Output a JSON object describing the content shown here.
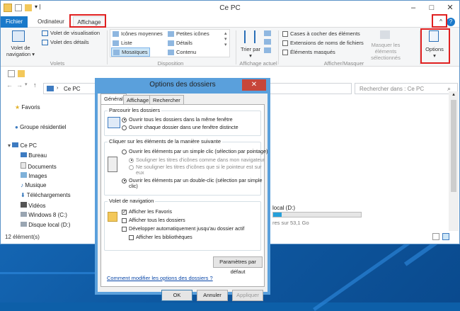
{
  "window": {
    "title": "Ce PC",
    "help": "?"
  },
  "tabs": [
    {
      "label": "Fichier"
    },
    {
      "label": "Ordinateur"
    },
    {
      "label": "Affichage"
    }
  ],
  "ribbon": {
    "volets": {
      "nav_pane": "Volet de navigation ▾",
      "preview": "Volet de visualisation",
      "details": "Volet des détails",
      "group": "Volets"
    },
    "disposition": {
      "items": [
        "Icônes moyennes",
        "Liste",
        "Mosaïques",
        "Petites icônes",
        "Détails",
        "Contenu"
      ],
      "selected": "Mosaïques",
      "group": "Disposition"
    },
    "affichage_actuel": {
      "sort": "Trier par ▾",
      "group": "Affichage actuel"
    },
    "afficher_masquer": {
      "items": [
        "Cases à cocher des éléments",
        "Extensions de noms de fichiers",
        "Éléments masqués"
      ],
      "hide_selected": "Masquer les éléments sélectionnés",
      "group": "Afficher/Masquer"
    },
    "options": {
      "label": "Options ▾"
    }
  },
  "address": {
    "path": "Ce PC",
    "search_placeholder": "Rechercher dans : Ce PC"
  },
  "nav": {
    "favorites": "Favoris",
    "homegroup": "Groupe résidentiel",
    "thispc": "Ce PC",
    "items": [
      "Bureau",
      "Documents",
      "Images",
      "Musique",
      "Téléchargements",
      "Vidéos",
      "Windows 8 (C:)",
      "Disque local (D:)"
    ]
  },
  "content": {
    "drive_name": "local (D:)",
    "drive_free": "res sur 53,1 Go",
    "drive_used_fraction": 0.1
  },
  "status": {
    "count": "12 élément(s)"
  },
  "dialog": {
    "title": "Options des dossiers",
    "close": "✕",
    "tabs": [
      "Général",
      "Affichage",
      "Rechercher"
    ],
    "browse": {
      "legend": "Parcourir les dossiers",
      "opt1": "Ouvrir tous les dossiers dans la même fenêtre",
      "opt2": "Ouvrir chaque dossier dans une fenêtre distincte"
    },
    "click": {
      "legend": "Cliquer sur les éléments de la manière suivante",
      "opt1": "Ouvrir les éléments par un simple clic (sélection par pointage)",
      "sub1": "Souligner les titres d'icônes comme dans mon navigateur",
      "sub2a": "Ne souligner les titres d'icônes que si le pointeur est sur",
      "sub2b": "eux",
      "opt2a": "Ouvrir les éléments par un double-clic (sélection par simple",
      "opt2b": "clic)"
    },
    "navpane": {
      "legend": "Volet de navigation",
      "c1": "Afficher les Favoris",
      "c2": "Afficher tous les dossiers",
      "c3": "Développer automatiquement jusqu'au dossier actif",
      "c4": "Afficher les bibliothèques"
    },
    "defaults": "Paramètres par défaut",
    "link": "Comment modifier les options des dossiers ?",
    "ok": "OK",
    "cancel": "Annuler",
    "apply": "Appliquer"
  },
  "colors": {
    "accent": "#1979ca",
    "highlight": "#e02020",
    "dialog_frame": "#5aa0dc"
  }
}
